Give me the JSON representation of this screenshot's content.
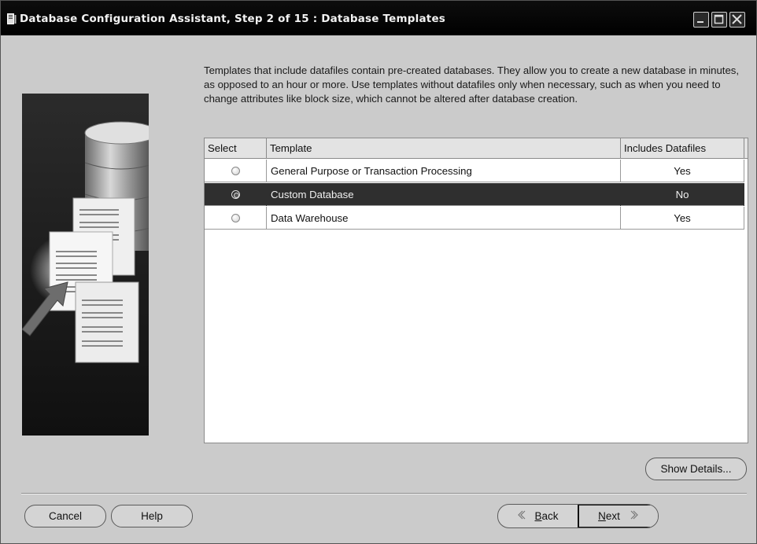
{
  "window": {
    "title": "Database Configuration Assistant, Step 2 of 15 : Database Templates"
  },
  "intro_text": "Templates that include datafiles contain pre-created databases. They allow you to create a new database in minutes, as opposed to an hour or more. Use templates without datafiles only when necessary, such as when you need to change attributes like block size, which cannot be altered after database creation.",
  "table": {
    "headers": [
      "Select",
      "Template",
      "Includes Datafiles"
    ],
    "rows": [
      {
        "template": "General Purpose or Transaction Processing",
        "includes_datafiles": "Yes",
        "selected": false
      },
      {
        "template": "Custom Database",
        "includes_datafiles": "No",
        "selected": true
      },
      {
        "template": "Data Warehouse",
        "includes_datafiles": "Yes",
        "selected": false
      }
    ]
  },
  "buttons": {
    "show_details": "Show Details...",
    "cancel": "Cancel",
    "help": "Help",
    "back_mnemonic": "B",
    "back_rest": "ack",
    "next_mnemonic": "N",
    "next_rest": "ext"
  },
  "icons": {
    "title": "application-icon",
    "back": "chevron-left-icon",
    "next": "chevron-right-icon"
  },
  "colors": {
    "selected_row": "#2f2f2f",
    "titlebar": "#000000"
  }
}
